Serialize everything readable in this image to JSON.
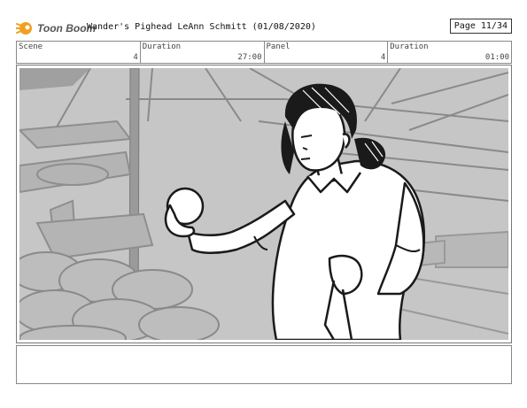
{
  "header": {
    "logo_text": "Toon Boom",
    "title": "Wander's Pighead  LeAnn Schmitt (01/08/2020)",
    "page": "Page 11/34"
  },
  "info": {
    "scene_label": "Scene",
    "scene_value": "4",
    "duration_label": "Duration",
    "duration_value": "27:00",
    "panel_label": "Panel",
    "panel_value": "4",
    "panel_duration_label": "Duration",
    "panel_duration_value": "01:00"
  },
  "colors": {
    "logo_accent": "#f0a020",
    "panel_bg": "#c6c6c6",
    "ink": "#1a1a1a"
  },
  "notes": {
    "text": ""
  }
}
